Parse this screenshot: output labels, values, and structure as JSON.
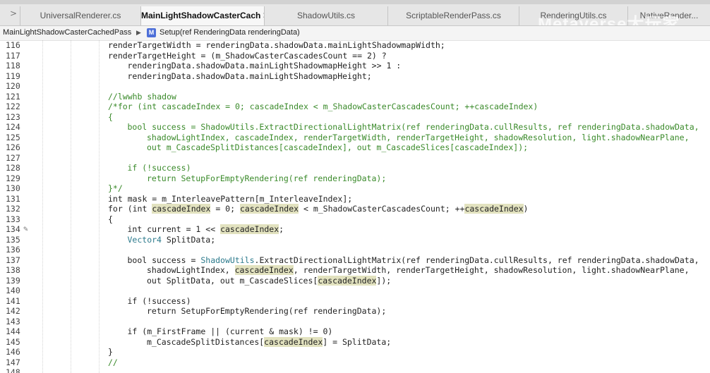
{
  "tabs": [
    {
      "label": "UniversalRenderer.cs",
      "active": false
    },
    {
      "label": "MainLightShadowCasterCach",
      "active": true
    },
    {
      "label": "ShadowUtils.cs",
      "active": false
    },
    {
      "label": "ScriptableRenderPass.cs",
      "active": false
    },
    {
      "label": "RenderingUtils.cs",
      "active": false
    },
    {
      "label": "NativeRender...",
      "active": false
    }
  ],
  "watermark": "Metaverse大玩家",
  "breadcrumb": {
    "class_name": "MainLightShadowCasterCachedPass",
    "method_icon": "M",
    "method": "Setup(ref RenderingData renderingData)"
  },
  "colors": {
    "comment": "#3a8a2a",
    "type": "#2c7a8c",
    "highlight": "#e2e2bf"
  },
  "lines": [
    {
      "n": "116",
      "indent": 0,
      "segs": [
        [
          "renderTargetWidth = renderingData.shadowData.mainLightShadowmapWidth;",
          ""
        ]
      ]
    },
    {
      "n": "117",
      "indent": 0,
      "segs": [
        [
          "renderTargetHeight = (m_ShadowCasterCascadesCount == 2) ?",
          ""
        ]
      ]
    },
    {
      "n": "118",
      "indent": 1,
      "segs": [
        [
          "renderingData.shadowData.mainLightShadowmapHeight >> 1 :",
          ""
        ]
      ]
    },
    {
      "n": "119",
      "indent": 1,
      "segs": [
        [
          "renderingData.shadowData.mainLightShadowmapHeight;",
          ""
        ]
      ]
    },
    {
      "n": "120",
      "indent": 0,
      "segs": []
    },
    {
      "n": "121",
      "indent": 0,
      "segs": [
        [
          "//lwwhb shadow",
          "cm"
        ]
      ]
    },
    {
      "n": "122",
      "indent": 0,
      "segs": [
        [
          "/*for (int cascadeIndex = 0; cascadeIndex < m_ShadowCasterCascadesCount; ++cascadeIndex)",
          "cm"
        ]
      ]
    },
    {
      "n": "123",
      "indent": 0,
      "segs": [
        [
          "{",
          "cm"
        ]
      ]
    },
    {
      "n": "124",
      "indent": 1,
      "segs": [
        [
          "bool success = ShadowUtils.ExtractDirectionalLightMatrix(ref renderingData.cullResults, ref renderingData.shadowData,",
          "cm"
        ]
      ]
    },
    {
      "n": "125",
      "indent": 2,
      "segs": [
        [
          "shadowLightIndex, cascadeIndex, renderTargetWidth, renderTargetHeight, shadowResolution, light.shadowNearPlane,",
          "cm"
        ]
      ]
    },
    {
      "n": "126",
      "indent": 2,
      "segs": [
        [
          "out m_CascadeSplitDistances[cascadeIndex], out m_CascadeSlices[cascadeIndex]);",
          "cm"
        ]
      ]
    },
    {
      "n": "127",
      "indent": 0,
      "segs": []
    },
    {
      "n": "128",
      "indent": 1,
      "segs": [
        [
          "if (!success)",
          "cm"
        ]
      ]
    },
    {
      "n": "129",
      "indent": 2,
      "segs": [
        [
          "return SetupForEmptyRendering(ref renderingData);",
          "cm"
        ]
      ]
    },
    {
      "n": "130",
      "indent": 0,
      "segs": [
        [
          "}*/",
          "cm"
        ]
      ]
    },
    {
      "n": "131",
      "indent": 0,
      "segs": [
        [
          "int mask = m_InterleavePattern[m_InterleaveIndex];",
          ""
        ]
      ]
    },
    {
      "n": "132",
      "indent": 0,
      "segs": [
        [
          "for (int ",
          ""
        ],
        [
          "cascadeIndex",
          "hl"
        ],
        [
          " = 0; ",
          ""
        ],
        [
          "cascadeIndex",
          "hl"
        ],
        [
          " < m_ShadowCasterCascadesCount; ++",
          ""
        ],
        [
          "cascadeIndex",
          "hl"
        ],
        [
          ")",
          ""
        ]
      ]
    },
    {
      "n": "133",
      "indent": 0,
      "segs": [
        [
          "{",
          ""
        ]
      ]
    },
    {
      "n": "134",
      "indent": 1,
      "segs": [
        [
          "int current = 1 << ",
          ""
        ],
        [
          "cascadeIndex",
          "hl"
        ],
        [
          ";",
          ""
        ]
      ]
    },
    {
      "n": "135",
      "indent": 1,
      "segs": [
        [
          "Vector4",
          "ty"
        ],
        [
          " SplitData;",
          ""
        ]
      ]
    },
    {
      "n": "136",
      "indent": 0,
      "segs": []
    },
    {
      "n": "137",
      "indent": 1,
      "segs": [
        [
          "bool success = ",
          ""
        ],
        [
          "ShadowUtils",
          "ty"
        ],
        [
          ".ExtractDirectionalLightMatrix(ref renderingData.cullResults, ref renderingData.shadowData,",
          ""
        ]
      ]
    },
    {
      "n": "138",
      "indent": 2,
      "segs": [
        [
          "shadowLightIndex, ",
          ""
        ],
        [
          "cascadeIndex",
          "hl"
        ],
        [
          ", renderTargetWidth, renderTargetHeight, shadowResolution, light.shadowNearPlane,",
          ""
        ]
      ]
    },
    {
      "n": "139",
      "indent": 2,
      "segs": [
        [
          "out SplitData, out m_CascadeSlices[",
          ""
        ],
        [
          "cascadeIndex",
          "hl"
        ],
        [
          "]);",
          ""
        ]
      ]
    },
    {
      "n": "140",
      "indent": 0,
      "segs": []
    },
    {
      "n": "141",
      "indent": 1,
      "segs": [
        [
          "if (!success)",
          ""
        ]
      ]
    },
    {
      "n": "142",
      "indent": 2,
      "segs": [
        [
          "return SetupForEmptyRendering(ref renderingData);",
          ""
        ]
      ]
    },
    {
      "n": "143",
      "indent": 0,
      "segs": []
    },
    {
      "n": "144",
      "indent": 1,
      "segs": [
        [
          "if (m_FirstFrame || (current & mask) != 0)",
          ""
        ]
      ]
    },
    {
      "n": "145",
      "indent": 2,
      "segs": [
        [
          "m_CascadeSplitDistances[",
          ""
        ],
        [
          "cascadeIndex",
          "hl"
        ],
        [
          "] = SplitData;",
          ""
        ]
      ]
    },
    {
      "n": "146",
      "indent": 0,
      "segs": [
        [
          "}",
          ""
        ]
      ]
    },
    {
      "n": "147",
      "indent": 0,
      "segs": [
        [
          "//",
          "cm"
        ]
      ]
    },
    {
      "n": "148",
      "indent": 0,
      "segs": []
    }
  ]
}
